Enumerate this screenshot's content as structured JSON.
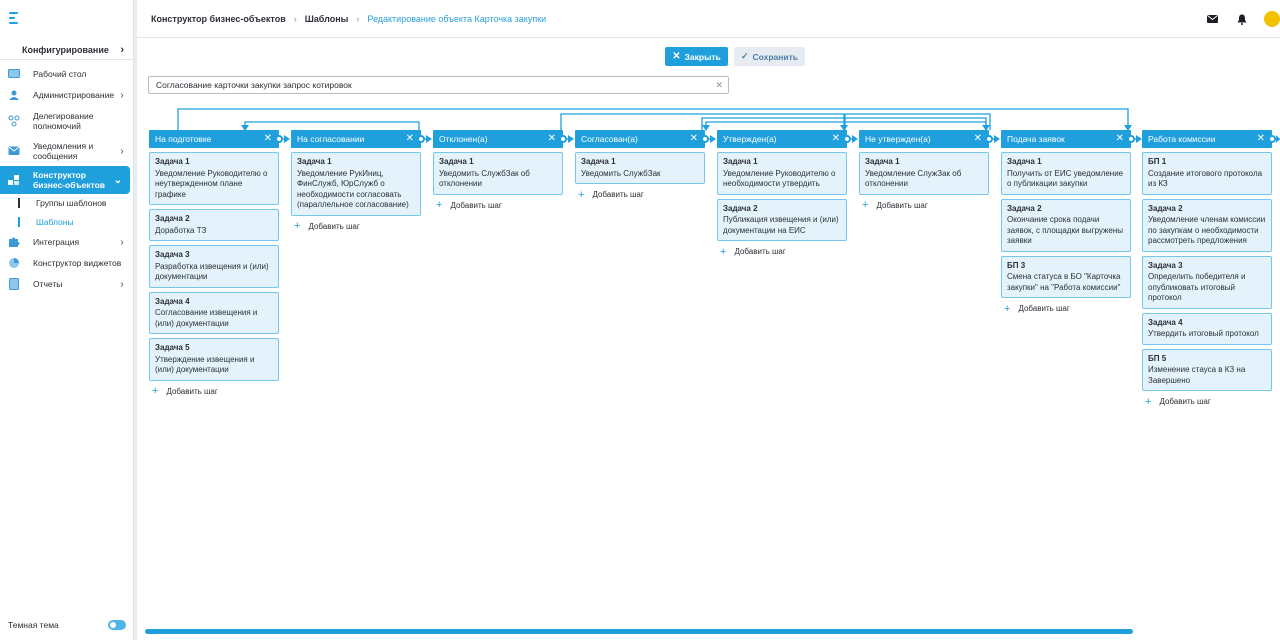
{
  "sidebar": {
    "config_label": "Конфигурирование",
    "items": [
      {
        "label": "Рабочий стол",
        "icon": "desktop-icon",
        "chevron": false
      },
      {
        "label": "Администрирование",
        "icon": "admin-icon",
        "chevron": true
      },
      {
        "label": "Делегирование полномочий",
        "icon": "delegation-icon",
        "chevron": false
      },
      {
        "label": "Уведомления и сообщения",
        "icon": "mail-icon",
        "chevron": true
      },
      {
        "label": "Конструктор бизнес-объектов",
        "icon": "constructor-icon",
        "chevron": true,
        "active": true
      },
      {
        "label": "Интеграция",
        "icon": "puzzle-icon",
        "chevron": true
      },
      {
        "label": "Конструктор виджетов",
        "icon": "widget-icon",
        "chevron": false
      },
      {
        "label": "Отчеты",
        "icon": "report-icon",
        "chevron": true
      }
    ],
    "subitems": [
      {
        "label": "Группы шаблонов",
        "selected": false
      },
      {
        "label": "Шаблоны",
        "selected": true
      }
    ],
    "theme_label": "Темная тема"
  },
  "header": {
    "breadcrumb": [
      "Конструктор бизнес-объектов",
      "Шаблоны",
      "Редактирование объекта Карточка закупки"
    ]
  },
  "toolbar": {
    "close_label": "Закрыть",
    "save_label": "Сохранить"
  },
  "object_name": {
    "value": "Согласование карточки закупки запрос котировок"
  },
  "add_step_label": "Добавить шаг",
  "colors": {
    "accent": "#1fa0dd",
    "card_bg": "#e4f3fb",
    "card_border": "#76c7ec"
  },
  "columns": [
    {
      "title": "На подготовке",
      "cards": [
        {
          "title": "Задача 1",
          "text": "Уведомление Руководителю о неутвержденном плане графике"
        },
        {
          "title": "Задача 2",
          "text": "Доработка ТЗ"
        },
        {
          "title": "Задача 3",
          "text": "Разработка извещения и (или) документации"
        },
        {
          "title": "Задача 4",
          "text": "Согласование извещения и (или) документации"
        },
        {
          "title": "Задача 5",
          "text": "Утверждение извещения и (или) документации"
        }
      ]
    },
    {
      "title": "На согласовании",
      "cards": [
        {
          "title": "Задача 1",
          "text": "Уведомление РукИниц, ФинСлужб, ЮрСлужб о необходимости согласовать (параллельное согласование)"
        }
      ]
    },
    {
      "title": "Отклонен(а)",
      "cards": [
        {
          "title": "Задача 1",
          "text": "Уведомить СлужбЗак об отклонении"
        }
      ]
    },
    {
      "title": "Согласован(а)",
      "cards": [
        {
          "title": "Задача 1",
          "text": "Уведомить СлужбЗак"
        }
      ]
    },
    {
      "title": "Утвержден(а)",
      "cards": [
        {
          "title": "Задача 1",
          "text": "Уведомление Руководителю о необходимости утвердить"
        },
        {
          "title": "Задача 2",
          "text": "Публикация извещения и (или) документации на ЕИС"
        }
      ]
    },
    {
      "title": "Не утвержден(а)",
      "cards": [
        {
          "title": "Задача 1",
          "text": "Уведомление СлужЗак об отклонении"
        }
      ]
    },
    {
      "title": "Подача заявок",
      "cards": [
        {
          "title": "Задача 1",
          "text": "Получить от ЕИС уведомление о публикации закупки"
        },
        {
          "title": "Задача 2",
          "text": "Окончание срока подачи заявок, с площадки выгружены заявки"
        },
        {
          "title": "БП 3",
          "text": "Смена статуса в БО \"Карточка закупки\" на \"Работа комиссии\""
        }
      ]
    },
    {
      "title": "Работа комиссии",
      "cards": [
        {
          "title": "БП 1",
          "text": "Создание итогового протокола из КЗ"
        },
        {
          "title": "Задача 2",
          "text": "Уведомление членам комиссии по закупкам о необходимости рассмотреть предложения"
        },
        {
          "title": "Задача 3",
          "text": "Определить победителя и опубликовать итоговый протокол"
        },
        {
          "title": "Задача 4",
          "text": "Утвердить итоговый протокол"
        },
        {
          "title": "БП 5",
          "text": "Изменение стауса в КЗ на Завершено"
        }
      ]
    }
  ]
}
